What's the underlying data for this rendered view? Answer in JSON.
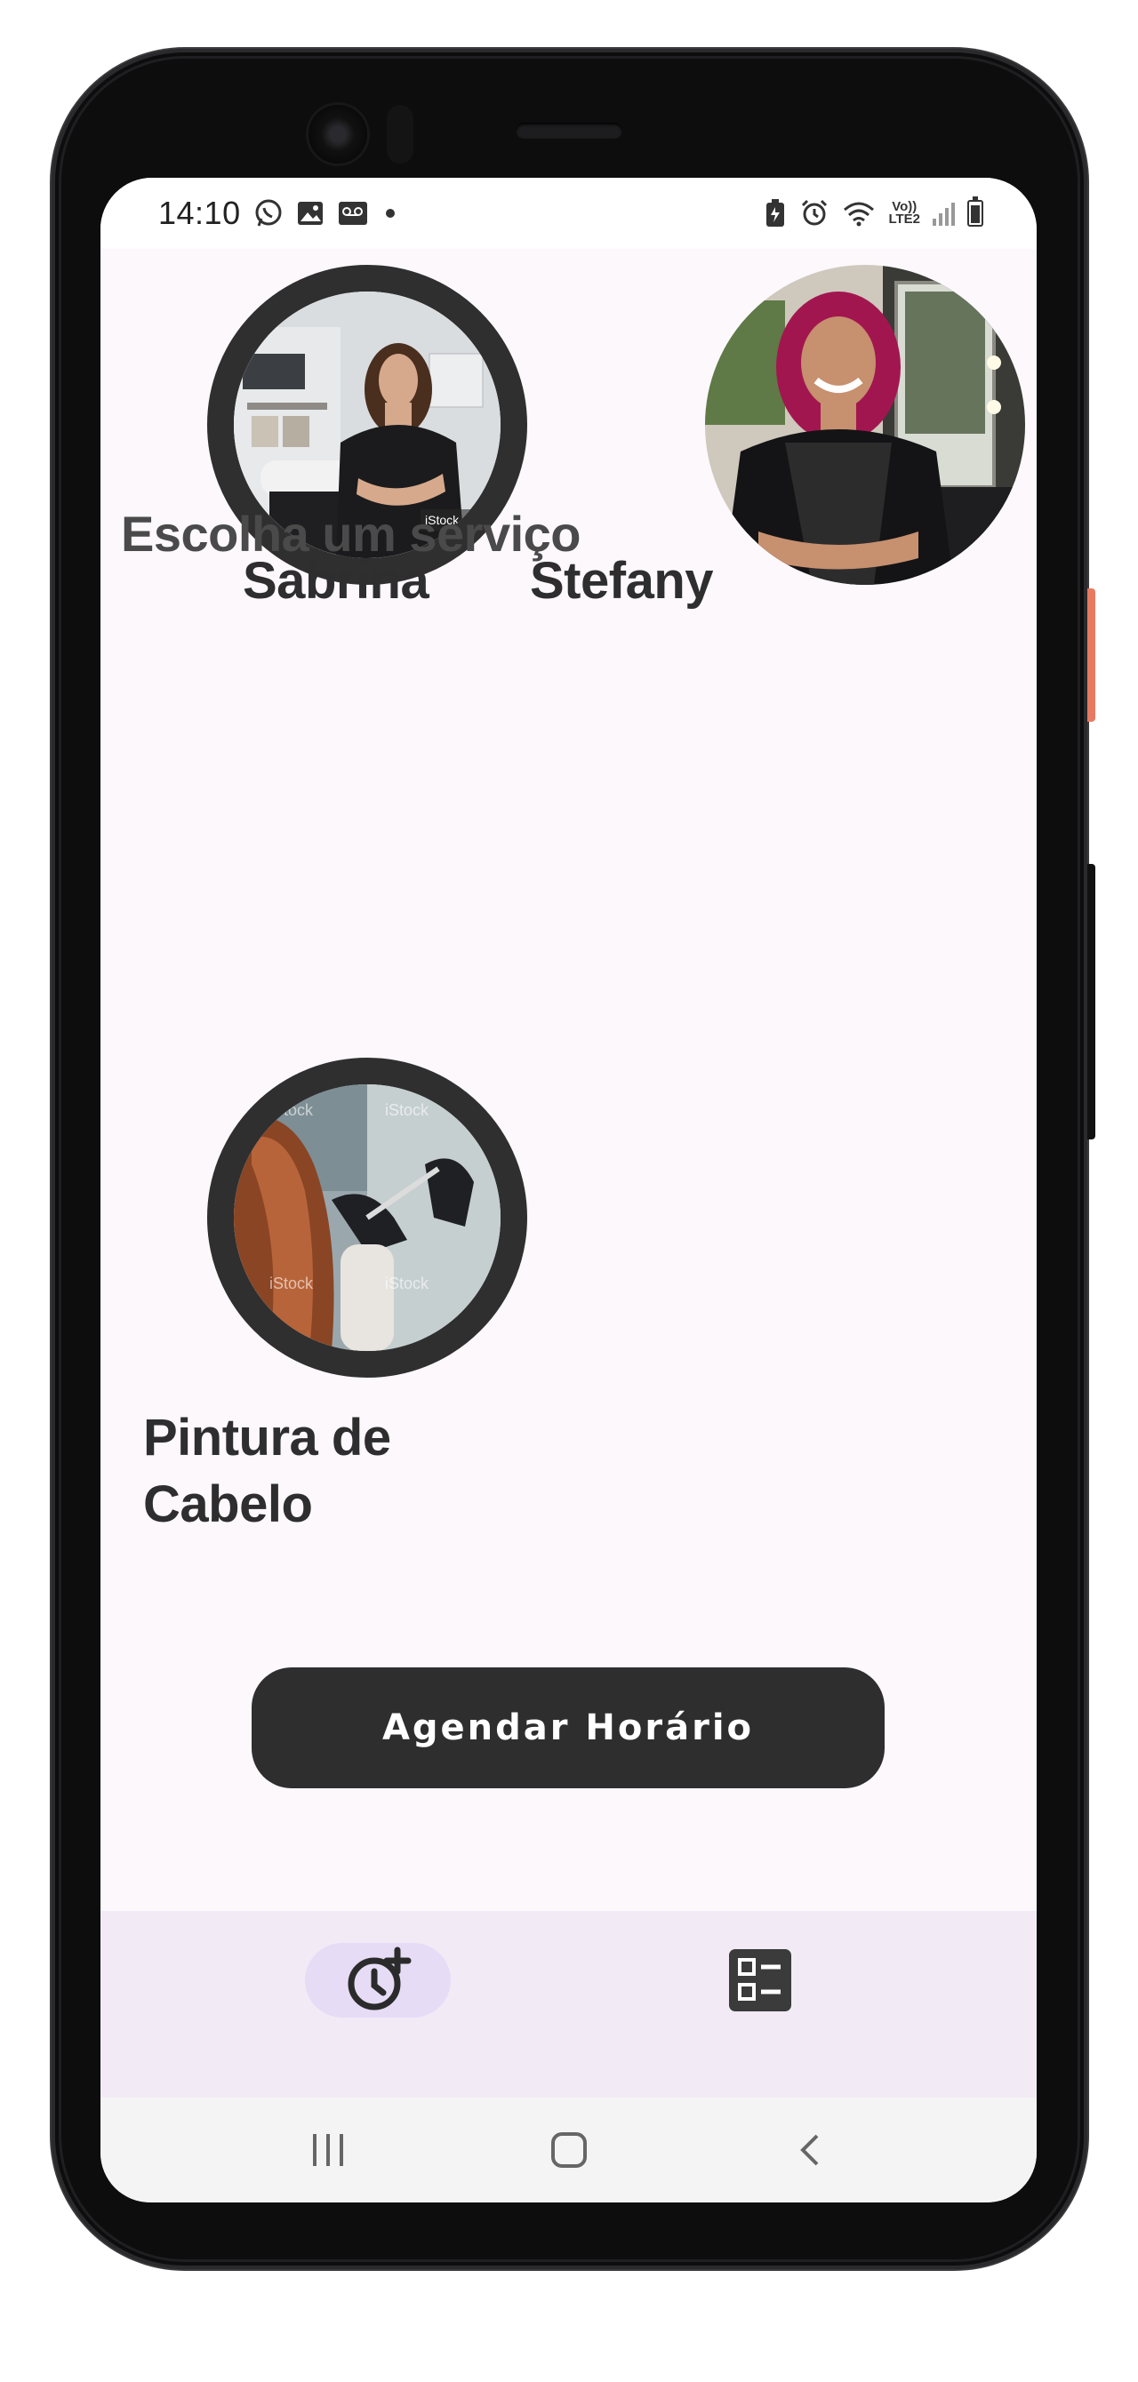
{
  "status_bar": {
    "time": "14:10",
    "left_icons": [
      "whatsapp-icon",
      "gallery-icon",
      "voicemail-icon",
      "dot-icon"
    ],
    "network_label_top": "Vo))",
    "network_label_bottom": "LTE2",
    "right_icons": [
      "battery-saver-icon",
      "alarm-icon",
      "wifi-icon",
      "signal-icon",
      "battery-icon"
    ]
  },
  "professionals": [
    {
      "name": "Sabrina",
      "avatar": "hairdresser-photo-1"
    },
    {
      "name": "Stefany",
      "avatar": "hairdresser-photo-2"
    }
  ],
  "services": {
    "title": "Escolha um serviço",
    "items": [
      {
        "name": "Pintura de Cabelo",
        "image": "hair-coloring-photo"
      }
    ]
  },
  "cta": {
    "label": "Agendar Horário"
  },
  "bottom_nav": {
    "items": [
      {
        "icon": "schedule-add-icon",
        "active": true
      },
      {
        "icon": "list-icon",
        "active": false
      }
    ]
  },
  "colors": {
    "screen_bg": "#fcf8fc",
    "dark": "#2e2e2e",
    "nav_bg": "#f2ebf6",
    "nav_active": "#e6dcf6"
  }
}
